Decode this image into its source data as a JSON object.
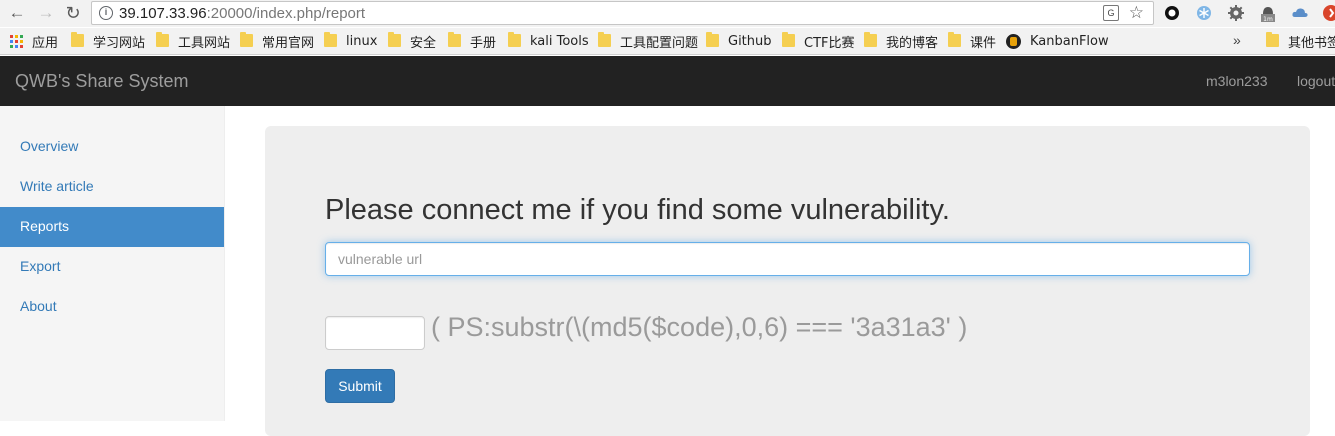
{
  "browser": {
    "url_host": "39.107.33.96",
    "url_rest": ":20000/index.php/report",
    "info_icon_glyph": "i",
    "translate_icon_glyph": "G"
  },
  "bookmarks": {
    "items": [
      {
        "label": "应用",
        "icon": "apps-grid-icon"
      },
      {
        "label": "学习网站",
        "icon": "folder-icon"
      },
      {
        "label": "工具网站",
        "icon": "folder-icon"
      },
      {
        "label": "常用官网",
        "icon": "folder-icon"
      },
      {
        "label": "linux",
        "icon": "folder-icon"
      },
      {
        "label": "安全",
        "icon": "folder-icon"
      },
      {
        "label": "手册",
        "icon": "folder-icon"
      },
      {
        "label": "kali Tools",
        "icon": "folder-icon"
      },
      {
        "label": "工具配置问题",
        "icon": "folder-icon"
      },
      {
        "label": "Github",
        "icon": "folder-icon"
      },
      {
        "label": "CTF比赛",
        "icon": "folder-icon"
      },
      {
        "label": "我的博客",
        "icon": "folder-icon"
      },
      {
        "label": "课件",
        "icon": "folder-icon"
      },
      {
        "label": "KanbanFlow",
        "icon": "kanbanflow-icon"
      },
      {
        "label": "其他书签",
        "icon": "folder-icon"
      }
    ],
    "more_glyph": "»"
  },
  "navbar": {
    "brand": "QWB's Share System",
    "username": "m3lon233",
    "logout": "logout"
  },
  "sidebar": {
    "items": [
      {
        "label": "Overview",
        "active": false
      },
      {
        "label": "Write article",
        "active": false
      },
      {
        "label": "Reports",
        "active": true
      },
      {
        "label": "Export",
        "active": false
      },
      {
        "label": "About",
        "active": false
      }
    ]
  },
  "report": {
    "heading": "Please connect me if you find some vulnerability.",
    "url_placeholder": "vulnerable url",
    "code_value": "",
    "ps_text": "( PS:substr(\\(md5($code),0,6) === '3a31a3' )",
    "submit_label": "Submit"
  },
  "colors": {
    "navbar_bg": "#222222",
    "navbar_text": "#9d9d9d",
    "sidebar_active": "#428bca",
    "link": "#337ab7",
    "jumbotron_bg": "#eeeeee",
    "button_primary": "#337ab7"
  }
}
